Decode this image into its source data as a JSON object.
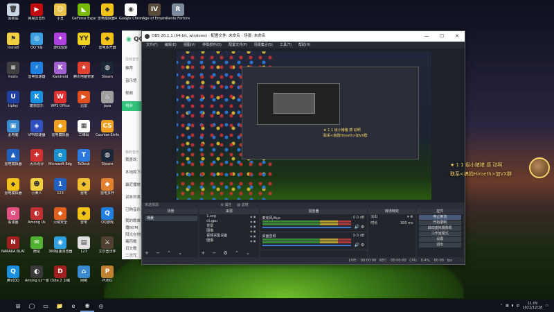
{
  "desktop": {
    "icons": [
      {
        "label": "回收站",
        "color": "#c9d6e4",
        "glyph": "🗑",
        "col": 0,
        "row": 0
      },
      {
        "label": "网易云音乐",
        "color": "#c20c0c",
        "glyph": "▶",
        "col": 1,
        "row": 0
      },
      {
        "label": "小丑",
        "color": "#e8c24a",
        "glyph": "☺",
        "col": 2,
        "row": 0
      },
      {
        "label": "GeForce Experience",
        "color": "#76b900",
        "glyph": "◣",
        "col": 3,
        "row": 0
      },
      {
        "label": "雷电模拟器4",
        "color": "#f2c218",
        "glyph": "◆",
        "col": 4,
        "row": 0
      },
      {
        "label": "Google Chrome",
        "color": "#ffffff",
        "glyph": "◉",
        "col": 5,
        "row": 0
      },
      {
        "label": "Age of Empires IV",
        "color": "#5a4a3a",
        "glyph": "IV",
        "col": 6,
        "row": 0
      },
      {
        "label": "Rento Fortune -...",
        "color": "#7a8a9a",
        "glyph": "R",
        "col": 7,
        "row": 0
      },
      {
        "label": "Icons8",
        "color": "#f0d040",
        "glyph": "⚑",
        "col": 0,
        "row": 1
      },
      {
        "label": "QQ飞车",
        "color": "#3a9fe0",
        "glyph": "◎",
        "col": 1,
        "row": 1
      },
      {
        "label": "游戏加加",
        "color": "#b040e0",
        "glyph": "✦",
        "col": 2,
        "row": 1
      },
      {
        "label": "YY",
        "color": "#f0d020",
        "glyph": "YY",
        "col": 3,
        "row": 1
      },
      {
        "label": "雷电多开器",
        "color": "#f2c218",
        "glyph": "◆",
        "col": 4,
        "row": 1
      },
      {
        "label": "雷电模拟器",
        "color": "#d0d0d0",
        "glyph": "▢",
        "col": 5,
        "row": 1
      },
      {
        "label": "酷我音乐",
        "color": "#f0a020",
        "glyph": "K",
        "col": 6,
        "row": 1
      },
      {
        "label": "hosts",
        "color": "#404040",
        "glyph": "≡",
        "col": 0,
        "row": 2
      },
      {
        "label": "雷神加速器",
        "color": "#2080e0",
        "glyph": "⚡",
        "col": 1,
        "row": 2
      },
      {
        "label": "Kandroid",
        "color": "#a060d0",
        "glyph": "K",
        "col": 2,
        "row": 2
      },
      {
        "label": "腾讯电脑管家",
        "color": "#e04030",
        "glyph": "★",
        "col": 3,
        "row": 2
      },
      {
        "label": "Steam",
        "color": "#1b2838",
        "glyph": "◍",
        "col": 4,
        "row": 2
      },
      {
        "label": "Uplay",
        "color": "#2040a0",
        "glyph": "U",
        "col": 0,
        "row": 3
      },
      {
        "label": "酷狗音乐",
        "color": "#1a90e0",
        "glyph": "K",
        "col": 1,
        "row": 3
      },
      {
        "label": "WPS Office",
        "color": "#e03030",
        "glyph": "W",
        "col": 2,
        "row": 3
      },
      {
        "label": "迅雷",
        "color": "#e05020",
        "glyph": "▶",
        "col": 3,
        "row": 3
      },
      {
        "label": "java",
        "color": "#a0a0a0",
        "glyph": "♨",
        "col": 4,
        "row": 3
      },
      {
        "label": "此电脑",
        "color": "#3a8ad0",
        "glyph": "▣",
        "col": 0,
        "row": 4
      },
      {
        "label": "VPN加速器",
        "color": "#3050c0",
        "glyph": "◈",
        "col": 1,
        "row": 4
      },
      {
        "label": "雷电模拟器",
        "color": "#f0a020",
        "glyph": "◆",
        "col": 2,
        "row": 4
      },
      {
        "label": "二维码",
        "color": "#ffffff",
        "glyph": "▦",
        "col": 3,
        "row": 4
      },
      {
        "label": "Counter-Strike",
        "color": "#f0a020",
        "glyph": "CS",
        "col": 4,
        "row": 4
      },
      {
        "label": "雷电模拟器",
        "color": "#2060c0",
        "glyph": "▲",
        "col": 0,
        "row": 5
      },
      {
        "label": "大众点评",
        "color": "#d03030",
        "glyph": "✚",
        "col": 1,
        "row": 5
      },
      {
        "label": "Microsoft Edge",
        "color": "#1a90d0",
        "glyph": "e",
        "col": 2,
        "row": 5
      },
      {
        "label": "ToDesk",
        "color": "#2a7ae0",
        "glyph": "T",
        "col": 3,
        "row": 5
      },
      {
        "label": "Steam",
        "color": "#1b2838",
        "glyph": "◍",
        "col": 4,
        "row": 5
      },
      {
        "label": "雷电模拟器",
        "color": "#f2c218",
        "glyph": "◆",
        "col": 0,
        "row": 6
      },
      {
        "label": "小黄人",
        "color": "#f0d040",
        "glyph": "☻",
        "col": 1,
        "row": 6
      },
      {
        "label": "123",
        "color": "#2060c0",
        "glyph": "1",
        "col": 2,
        "row": 6
      },
      {
        "label": "雷电",
        "color": "#f0c030",
        "glyph": "◆",
        "col": 3,
        "row": 6
      },
      {
        "label": "雷电多开",
        "color": "#e08030",
        "glyph": "◆",
        "col": 4,
        "row": 6
      },
      {
        "label": "看漫画",
        "color": "#e05080",
        "glyph": "✿",
        "col": 0,
        "row": 7
      },
      {
        "label": "Among Us",
        "color": "#c03030",
        "glyph": "◐",
        "col": 1,
        "row": 7
      },
      {
        "label": "火绒安全",
        "color": "#e06020",
        "glyph": "◆",
        "col": 2,
        "row": 7
      },
      {
        "label": "雷电",
        "color": "#f2c218",
        "glyph": "◆",
        "col": 3,
        "row": 7
      },
      {
        "label": "QQ游戏",
        "color": "#2080e0",
        "glyph": "Q",
        "col": 4,
        "row": 7
      },
      {
        "label": "NARAKA BLADEPOI...",
        "color": "#a02020",
        "glyph": "N",
        "col": 0,
        "row": 8
      },
      {
        "label": "微信",
        "color": "#50b030",
        "glyph": "✉",
        "col": 1,
        "row": 8
      },
      {
        "label": "360极速浏览器",
        "color": "#30a0e0",
        "glyph": "◉",
        "col": 2,
        "row": 8
      },
      {
        "label": "123",
        "color": "#e0e0e0",
        "glyph": "▤",
        "col": 3,
        "row": 8
      },
      {
        "label": "艾尔登法环",
        "color": "#504030",
        "glyph": "⚔",
        "col": 4,
        "row": 8
      },
      {
        "label": "腾讯QQ",
        "color": "#1a90e0",
        "glyph": "Q",
        "col": 0,
        "row": 9
      },
      {
        "label": "Among us一键汉化",
        "color": "#3a3a3a",
        "glyph": "◐",
        "col": 1,
        "row": 9
      },
      {
        "label": "Dota 2 卫域",
        "color": "#a02020",
        "glyph": "D",
        "col": 2,
        "row": 9
      },
      {
        "label": "网络",
        "color": "#3a8ad0",
        "glyph": "⌂",
        "col": 3,
        "row": 9
      },
      {
        "label": "PUBG",
        "color": "#c08030",
        "glyph": "P",
        "col": 4,
        "row": 9
      }
    ]
  },
  "qq_music": {
    "logo": "QQ",
    "section_online": "在线音乐",
    "nav": [
      {
        "label": "推荐",
        "active": false
      },
      {
        "label": "音乐馆",
        "active": false
      },
      {
        "label": "视频",
        "active": false
      },
      {
        "label": "电台",
        "active": true
      }
    ],
    "section_my": "我的音乐",
    "nav_my": [
      "我喜欢",
      "本地和下载",
      "最近播放",
      "试听列表",
      "已购音乐"
    ],
    "extras": [
      "我的歌单",
      "播BGM",
      "阳光在你手心",
      "毒药歌",
      "日文歌",
      "二次元"
    ]
  },
  "obs": {
    "title": "OBS 26.1.1 (64-bit, windows) - 配置文件: 未命名 - 场景: 未命名",
    "window_buttons": [
      "—",
      "☐",
      "✕"
    ],
    "menu": [
      "文件(F)",
      "编辑(E)",
      "视图(V)",
      "停靠部件(D)",
      "配置文件(P)",
      "场景集合(S)",
      "工具(T)",
      "帮助(H)"
    ],
    "preview_caption_line1": "★ 1 1 级小猪猪 感 动啊",
    "preview_caption_line2": "联系<搞戮Hiroeth>加VX群",
    "source_status": "未选择源",
    "status_tabs": [
      "⚙ 属性",
      "▨ 滤镜"
    ],
    "docks": {
      "scenes": {
        "title": "场景",
        "items": [
          "场景"
        ]
      },
      "sources": {
        "title": "来源",
        "items": [
          "1.svg",
          "di.gpu",
          "背景",
          "图像",
          "视频采集设备",
          "图像"
        ]
      },
      "mixer": {
        "title": "混音器",
        "channels": [
          {
            "name": "麦克风/Aux",
            "db": "0.0 dB"
          },
          {
            "name": "桌面音频",
            "db": "0.0 dB"
          }
        ]
      },
      "transitions": {
        "title": "转场特效",
        "type": "淡出",
        "duration_label": "时长",
        "duration_value": "300 ms"
      },
      "controls": {
        "title": "控件",
        "buttons": [
          "停止推流",
          "开始录制",
          "启动虚拟摄像机",
          "工作室模式",
          "设置",
          "退出"
        ]
      }
    },
    "statusbar": "LIVE: 00:00:00   REC: 00:00:00   CPU: 0.4%, 60.00 fps"
  },
  "overlay_caption": {
    "line1": "★ 1 1 级小猪猪 感 动啊",
    "line2": "联系<搞戮Hiroeth>加VX群"
  },
  "taskbar": {
    "items": [
      {
        "name": "start-button",
        "glyph": "⊞",
        "active": false
      },
      {
        "name": "search-button",
        "glyph": "◯",
        "active": false
      },
      {
        "name": "task-view-button",
        "glyph": "▭",
        "active": false
      },
      {
        "name": "explorer-button",
        "glyph": "📁",
        "active": false
      },
      {
        "name": "edge-button",
        "glyph": "e",
        "active": false
      },
      {
        "name": "obs-button",
        "glyph": "◉",
        "active": true
      },
      {
        "name": "chrome-button",
        "glyph": "◎",
        "active": false
      }
    ],
    "time": "11:09",
    "date": "2022/12/28",
    "lang": "中"
  }
}
